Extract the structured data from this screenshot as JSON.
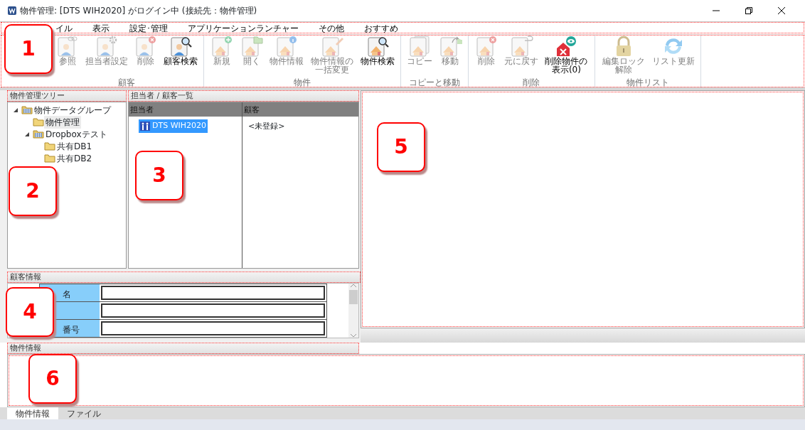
{
  "window": {
    "title": "物件管理: [DTS WIH2020] がログイン中 (接続先：物件管理)"
  },
  "menu": [
    {
      "label": "イル"
    },
    {
      "label": "表示"
    },
    {
      "label": "設定･管理"
    },
    {
      "label": "アプリケーションランチャー"
    },
    {
      "label": "その他"
    },
    {
      "label": "おすすめ"
    }
  ],
  "ribbon": [
    {
      "label": "顧客",
      "buttons": [
        {
          "label": "参照",
          "disabled": true
        },
        {
          "label": "担当者設定",
          "disabled": true
        },
        {
          "label": "削除",
          "disabled": true
        },
        {
          "label": "顧客検索",
          "disabled": false
        }
      ]
    },
    {
      "label": "物件",
      "buttons": [
        {
          "label": "新規",
          "disabled": true
        },
        {
          "label": "開く",
          "disabled": true
        },
        {
          "label": "物件情報",
          "disabled": true
        },
        {
          "label": "物件情報の一括変更",
          "disabled": true
        },
        {
          "label": "物件検索",
          "disabled": false
        }
      ]
    },
    {
      "label": "コピーと移動",
      "buttons": [
        {
          "label": "コピー",
          "disabled": true
        },
        {
          "label": "移動",
          "disabled": true
        }
      ]
    },
    {
      "label": "削除",
      "buttons": [
        {
          "label": "削除",
          "disabled": true
        },
        {
          "label": "元に戻す",
          "disabled": true
        },
        {
          "label": "削除物件の表示(0)",
          "disabled": false
        }
      ]
    },
    {
      "label": "物件リスト",
      "buttons": [
        {
          "label": "編集ロック解除",
          "disabled": true
        },
        {
          "label": "リスト更新",
          "disabled": true
        }
      ]
    }
  ],
  "tree": {
    "title": "物件管理ツリー",
    "items": [
      {
        "label": "物件データグループ",
        "expanded": true,
        "selected": false,
        "children": [
          {
            "label": "物件管理",
            "selected": true
          },
          {
            "label": "Dropboxテスト",
            "expanded": true,
            "selected": false,
            "children": [
              {
                "label": "共有DB1",
                "selected": false
              },
              {
                "label": "共有DB2",
                "selected": false
              }
            ]
          }
        ]
      }
    ]
  },
  "list": {
    "title": "担当者 / 顧客一覧",
    "columns": [
      "担当者",
      "顧客"
    ],
    "rows": [
      {
        "cells": [
          "DTS WIH2020",
          "<未登録>"
        ],
        "selected": true
      }
    ]
  },
  "customer_info": {
    "title": "顧客情報",
    "fields": [
      {
        "kind": "labeled",
        "label": "名"
      },
      {
        "kind": "unlabeled"
      },
      {
        "kind": "labeled",
        "label": "番号"
      }
    ]
  },
  "property_info": {
    "title": "物件情報",
    "tabs": [
      {
        "label": "物件情報",
        "selected": true
      },
      {
        "label": "ファイル",
        "selected": false
      }
    ]
  },
  "callouts": [
    {
      "number": "1"
    },
    {
      "number": "2"
    },
    {
      "number": "3"
    },
    {
      "number": "4"
    },
    {
      "number": "5"
    },
    {
      "number": "6"
    }
  ]
}
